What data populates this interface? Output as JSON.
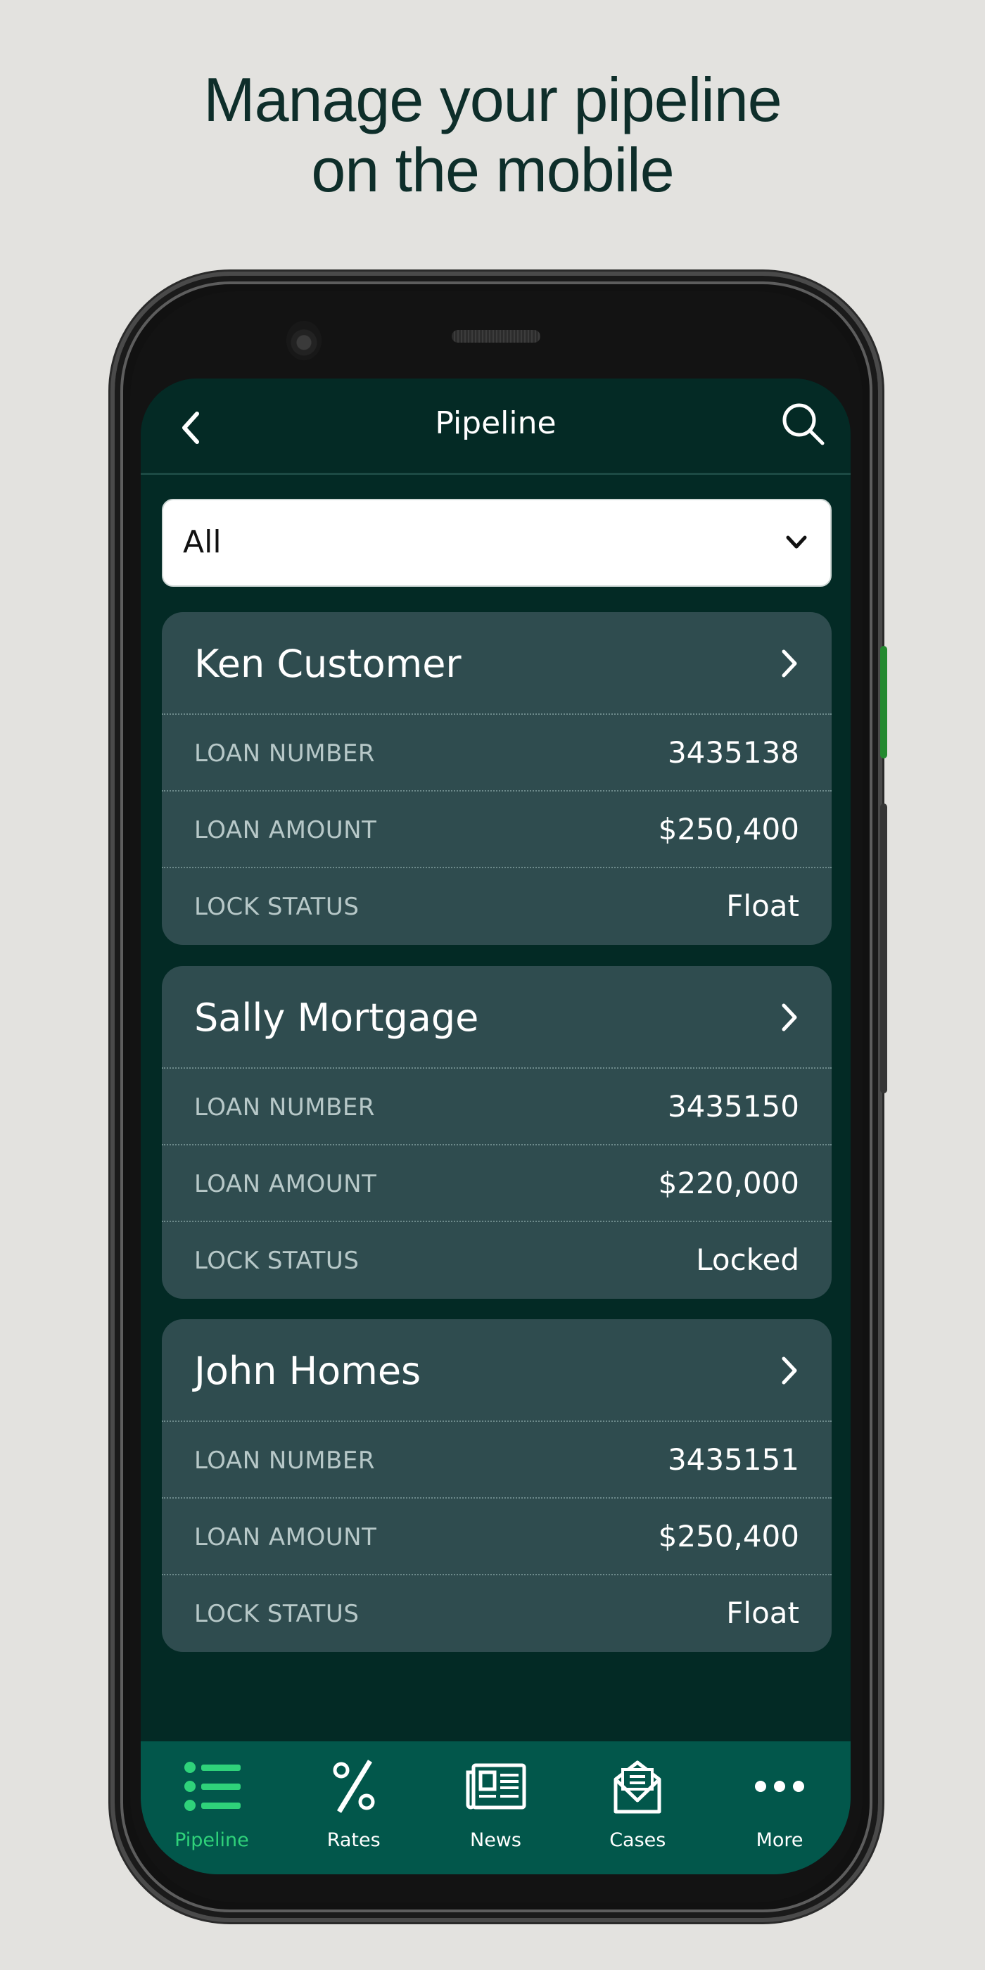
{
  "headline": {
    "line1": "Manage your pipeline",
    "line2": "on the mobile"
  },
  "colors": {
    "background": "#e3e2df",
    "headline": "#0e2e2a",
    "screen_bg": "#032a25",
    "card_bg": "#2f4c4f",
    "nav_bg": "#02574b",
    "active_accent": "#2fd27a",
    "side_button_accent": "#23892f"
  },
  "app": {
    "header": {
      "title": "Pipeline",
      "back_icon": "chevron-left-icon",
      "search_icon": "search-icon"
    },
    "filter": {
      "selected": "All",
      "icon": "chevron-down-icon"
    },
    "loans": [
      {
        "name": "Ken Customer",
        "rows": [
          {
            "label": "LOAN NUMBER",
            "value": "3435138"
          },
          {
            "label": "LOAN AMOUNT",
            "value": "$250,400"
          },
          {
            "label": "LOCK STATUS",
            "value": "Float"
          }
        ]
      },
      {
        "name": "Sally Mortgage",
        "rows": [
          {
            "label": "LOAN NUMBER",
            "value": "3435150"
          },
          {
            "label": "LOAN AMOUNT",
            "value": "$220,000"
          },
          {
            "label": "LOCK STATUS",
            "value": "Locked"
          }
        ]
      },
      {
        "name": "John Homes",
        "rows": [
          {
            "label": "LOAN NUMBER",
            "value": "3435151"
          },
          {
            "label": "LOAN AMOUNT",
            "value": "$250,400"
          },
          {
            "label": "LOCK STATUS",
            "value": "Float"
          }
        ]
      }
    ],
    "nav": [
      {
        "label": "Pipeline",
        "icon": "list-icon",
        "active": true
      },
      {
        "label": "Rates",
        "icon": "percent-icon",
        "active": false
      },
      {
        "label": "News",
        "icon": "newspaper-icon",
        "active": false
      },
      {
        "label": "Cases",
        "icon": "envelope-open-icon",
        "active": false
      },
      {
        "label": "More",
        "icon": "more-dots-icon",
        "active": false
      }
    ]
  }
}
